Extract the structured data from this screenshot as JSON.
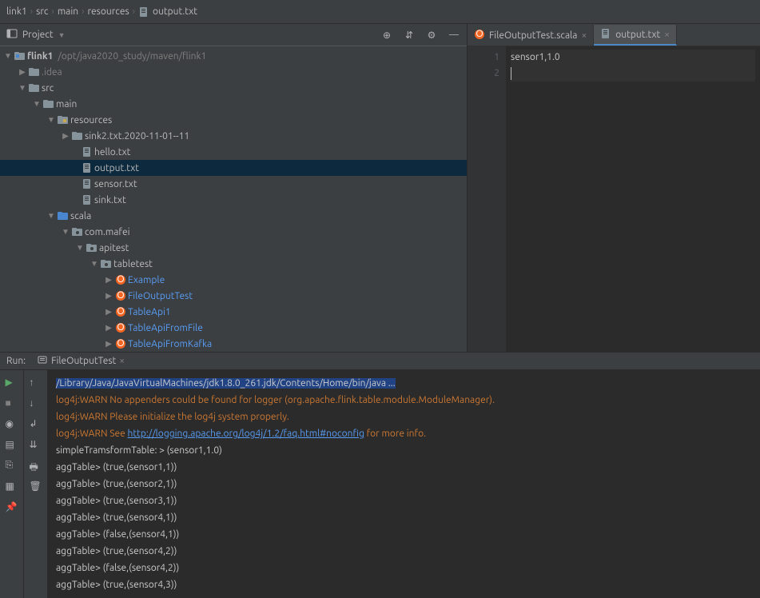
{
  "breadcrumb": [
    "link1",
    "src",
    "main",
    "resources",
    "output.txt"
  ],
  "project": {
    "title": "Project",
    "root": {
      "name": "flink1",
      "path": "/opt/java2020_study/maven/flink1"
    },
    "idea": ".idea",
    "src": "src",
    "main": "main",
    "resources": "resources",
    "sink2": "sink2.txt.2020-11-01--11",
    "hello": "hello.txt",
    "output": "output.txt",
    "sensor": "sensor.txt",
    "sink": "sink.txt",
    "scala": "scala",
    "pkg": "com.mafei",
    "apitest": "apitest",
    "tabletest": "tabletest",
    "example": "Example",
    "fot": "FileOutputTest",
    "tapi1": "TableApi1",
    "taff": "TableApiFromFile",
    "tafk": "TableApiFromKafka"
  },
  "editor": {
    "tabs": [
      {
        "name": "FileOutputTest.scala",
        "type": "scala"
      },
      {
        "name": "output.txt",
        "type": "txt"
      }
    ],
    "gutter": [
      "1",
      "2"
    ],
    "content": "sensor1,1.0"
  },
  "run": {
    "label": "Run:",
    "tab": "FileOutputTest",
    "console": {
      "cmd": "/Library/Java/JavaVirtualMachines/jdk1.8.0_261.jdk/Contents/Home/bin/java ...",
      "w1": "log4j:WARN No appenders could be found for logger (org.apache.flink.table.module.ModuleManager).",
      "w2": "log4j:WARN Please initialize the log4j system properly.",
      "w3a": "log4j:WARN See ",
      "w3link": "http://logging.apache.org/log4j/1.2/faq.html#noconfig",
      "w3b": " for more info.",
      "l1": "simpleTramsformTable: > (sensor1,1.0)",
      "l2": "aggTable> (true,(sensor1,1))",
      "l3": "aggTable> (true,(sensor2,1))",
      "l4": "aggTable> (true,(sensor3,1))",
      "l5": "aggTable> (true,(sensor4,1))",
      "l6": "aggTable> (false,(sensor4,1))",
      "l7": "aggTable> (true,(sensor4,2))",
      "l8": "aggTable> (false,(sensor4,2))",
      "l9": "aggTable> (true,(sensor4,3))"
    }
  }
}
